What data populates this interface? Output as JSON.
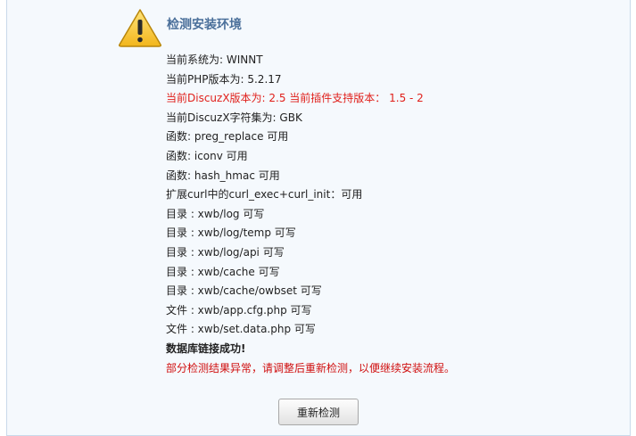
{
  "header": {
    "icon": "warning-icon",
    "title": "检测安装环境"
  },
  "checks": [
    {
      "text": "当前系统为: WINNT",
      "status": "normal"
    },
    {
      "text": "当前PHP版本为: 5.2.17",
      "status": "normal"
    },
    {
      "text": "当前DiscuzX版本为: 2.5 当前插件支持版本： 1.5 - 2",
      "status": "error"
    },
    {
      "text": "当前DiscuzX字符集为: GBK",
      "status": "normal"
    },
    {
      "text": "函数: preg_replace 可用",
      "status": "normal"
    },
    {
      "text": "函数: iconv 可用",
      "status": "normal"
    },
    {
      "text": "函数: hash_hmac 可用",
      "status": "normal"
    },
    {
      "text": "扩展curl中的curl_exec+curl_init：可用",
      "status": "normal"
    },
    {
      "text": "目录 : xwb/log 可写",
      "status": "normal"
    },
    {
      "text": "目录 : xwb/log/temp 可写",
      "status": "normal"
    },
    {
      "text": "目录 : xwb/log/api 可写",
      "status": "normal"
    },
    {
      "text": "目录 : xwb/cache 可写",
      "status": "normal"
    },
    {
      "text": "目录 : xwb/cache/owbset 可写",
      "status": "normal"
    },
    {
      "text": "文件 : xwb/app.cfg.php 可写",
      "status": "normal"
    },
    {
      "text": "文件 : xwb/set.data.php 可写",
      "status": "normal"
    },
    {
      "text": "数据库链接成功!",
      "status": "bold"
    },
    {
      "text": "部分检测结果异常，请调整后重新检测，以便继续安装流程。",
      "status": "warning"
    }
  ],
  "actions": {
    "recheck_label": "重新检测"
  },
  "colors": {
    "title": "#4a6f9a",
    "error": "#e0201b",
    "warning": "#d01010",
    "panel_bg": "#f5f9fd",
    "panel_border": "#c9d9ea"
  }
}
